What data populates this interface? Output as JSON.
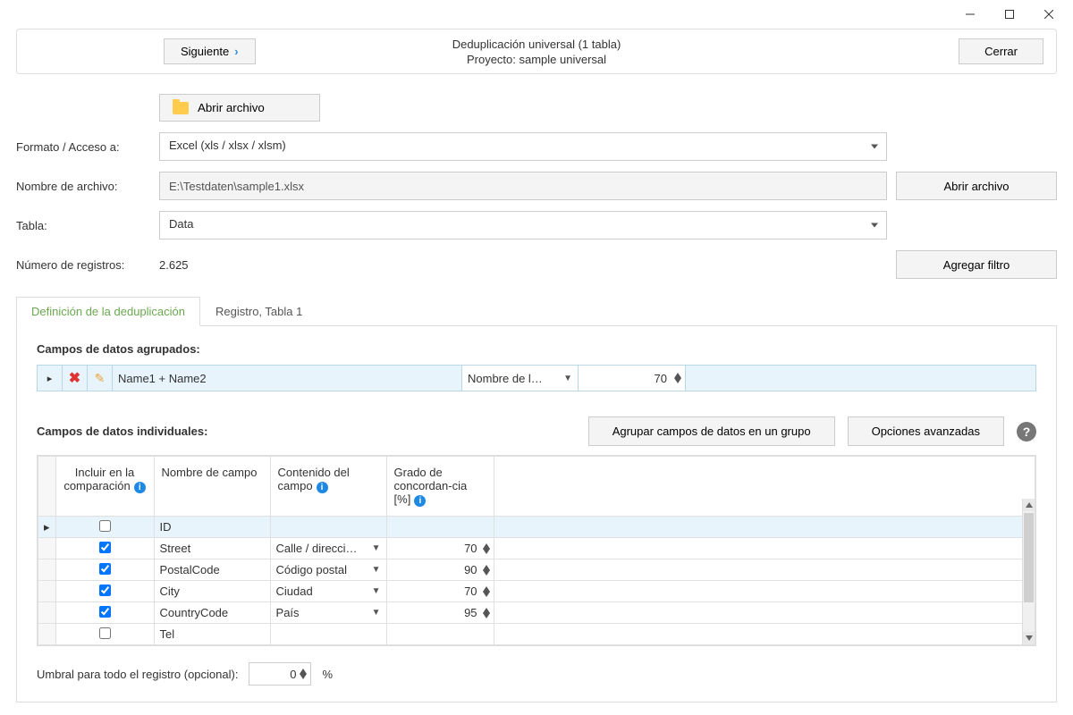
{
  "titlebar": {
    "min": "min",
    "max": "max",
    "close": "close"
  },
  "header": {
    "next": "Siguiente",
    "title": "Deduplicación universal (1 tabla)",
    "subtitle": "Proyecto: sample universal",
    "close": "Cerrar"
  },
  "form": {
    "open_file_btn": "Abrir archivo",
    "format_label": "Formato / Acceso a:",
    "format_value": "Excel (xls / xlsx / xlsm)",
    "filename_label": "Nombre de archivo:",
    "filename_value": "E:\\Testdaten\\sample1.xlsx",
    "open_file_action": "Abrir archivo",
    "table_label": "Tabla:",
    "table_value": "Data",
    "records_label": "Número de registros:",
    "records_value": "2.625",
    "add_filter": "Agregar filtro"
  },
  "tabs": {
    "t1": "Definición de la deduplicación",
    "t2": "Registro, Tabla 1"
  },
  "grouped": {
    "label": "Campos de datos agrupados:",
    "name": "Name1 + Name2",
    "type": "Nombre de l…",
    "match": "70"
  },
  "individual": {
    "label": "Campos de datos individuales:",
    "group_btn": "Agrupar campos de datos en un grupo",
    "advanced_btn": "Opciones avanzadas"
  },
  "columns": {
    "include": "Incluir en la comparación",
    "name": "Nombre de campo",
    "content": "Contenido del campo",
    "match": "Grado de concordan-cia [%]"
  },
  "rows": [
    {
      "checked": false,
      "name": "ID",
      "content": "",
      "match": "",
      "selected": true
    },
    {
      "checked": true,
      "name": "Street",
      "content": "Calle / direcci…",
      "match": "70",
      "selected": false
    },
    {
      "checked": true,
      "name": "PostalCode",
      "content": "Código postal",
      "match": "90",
      "selected": false
    },
    {
      "checked": true,
      "name": "City",
      "content": "Ciudad",
      "match": "70",
      "selected": false
    },
    {
      "checked": true,
      "name": "CountryCode",
      "content": "País",
      "match": "95",
      "selected": false
    },
    {
      "checked": false,
      "name": "Tel",
      "content": "",
      "match": "",
      "selected": false
    }
  ],
  "threshold": {
    "label": "Umbral para todo el registro (opcional):",
    "value": "0",
    "unit": "%"
  }
}
